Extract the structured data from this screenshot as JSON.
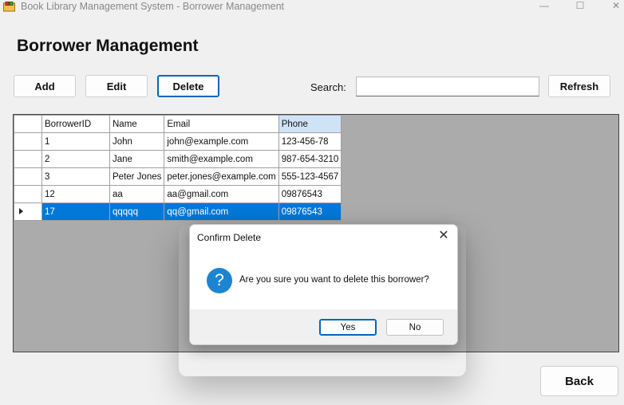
{
  "window": {
    "title": "Book Library Management System - Borrower Management",
    "minimize_glyph": "—",
    "maximize_glyph": "☐",
    "close_glyph": "✕"
  },
  "page": {
    "title": "Borrower Management"
  },
  "toolbar": {
    "add_label": "Add",
    "edit_label": "Edit",
    "delete_label": "Delete",
    "refresh_label": "Refresh",
    "search_label": "Search:",
    "search_value": ""
  },
  "grid": {
    "columns": [
      "BorrowerID",
      "Name",
      "Email",
      "Phone"
    ],
    "sorted_column": "Phone",
    "rows": [
      {
        "id": "1",
        "name": "John",
        "email": "john@example.com",
        "phone": "123-456-78"
      },
      {
        "id": "2",
        "name": "Jane",
        "email": "smith@example.com",
        "phone": "987-654-3210"
      },
      {
        "id": "3",
        "name": "Peter Jones",
        "email": "peter.jones@example.com",
        "phone": "555-123-4567"
      },
      {
        "id": "12",
        "name": "aa",
        "email": "aa@gmail.com",
        "phone": "09876543"
      },
      {
        "id": "17",
        "name": "qqqqq",
        "email": "qq@gmail.com",
        "phone": "09876543"
      }
    ],
    "selected_row": 4
  },
  "dialog": {
    "title": "Confirm Delete",
    "close_glyph": "✕",
    "icon": "question-icon",
    "icon_glyph": "?",
    "message": "Are you sure you want to delete this borrower?",
    "yes_label": "Yes",
    "no_label": "No"
  },
  "footer": {
    "back_label": "Back"
  },
  "colors": {
    "accent": "#0078d7",
    "selection": "#0078d7",
    "grid_background": "#ababab",
    "question_icon": "#1d84d1"
  }
}
